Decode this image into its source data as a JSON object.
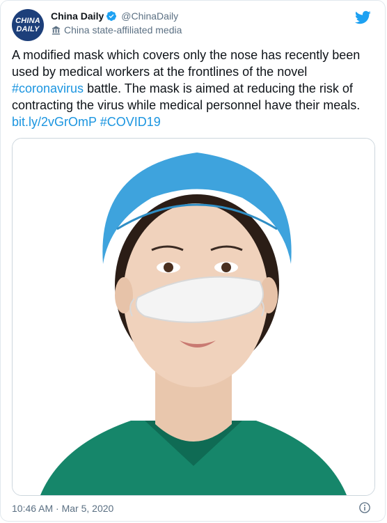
{
  "tweet": {
    "avatar_line1": "CHINA",
    "avatar_line2": "DAILY",
    "display_name": "China Daily",
    "handle": "@ChinaDaily",
    "affiliation": "China state-affiliated media",
    "text_part1": "A modified mask which covers only the nose has recently been used by medical workers at the frontlines of the novel ",
    "hashtag1": "#coronavirus",
    "text_part2": " battle. The mask is aimed at reducing the risk of contracting the virus while medical personnel have their meals. ",
    "link": "bit.ly/2vGrOmP",
    "text_part3": " ",
    "hashtag2": "#COVID19",
    "timestamp": "10:46 AM · Mar 5, 2020"
  },
  "icons": {
    "verified": "verified-badge-icon",
    "affiliation": "state-media-icon",
    "twitter": "twitter-bird-icon",
    "info": "info-icon"
  },
  "colors": {
    "link": "#1b95e0",
    "verified": "#1da1f2",
    "brand": "#1da1f2",
    "secondary_text": "#5b7083",
    "avatar_bg": "#1d3f7a",
    "scrubs": "#16866a",
    "cap": "#3ea3dd"
  }
}
